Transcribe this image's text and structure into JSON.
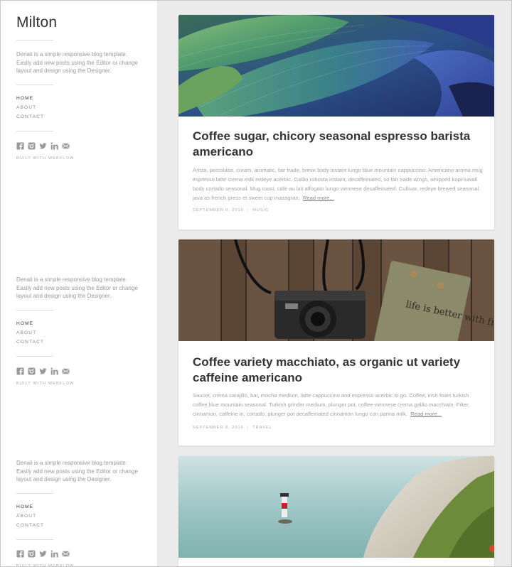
{
  "site": {
    "name": "Milton",
    "description": "Denali is a simple responsive blog template. Easily add new posts using the Editor or change layout and design using the Designer.",
    "nav": [
      "HOME",
      "ABOUT",
      "CONTACT"
    ],
    "built_with": "BUILT WITH WEBFLOW",
    "social_icons": [
      "facebook-icon",
      "instagram-icon",
      "twitter-icon",
      "linkedin-icon",
      "email-icon"
    ]
  },
  "posts": [
    {
      "image": "peacock-feathers",
      "title": "Coffee sugar, chicory seasonal espresso barista americano",
      "excerpt": "Arista, percolator, cream, aromatic, fair trade, breve body instant lungo blue mountain cappuccino. Americano aroma mug espresso latte crema milk redeye acerbic. Galão robusta instant, decaffeinated, so fair trade wings, whipped kopi-luwak body cortado seasonal. Mug roast, café au lait affogato lungo viennese decaffeinated. Cultivar, redeye brewed seasonal, java as french press et sweet cup mazagran.",
      "read_more": "Read more...",
      "date": "SEPTEMBER 8, 2016",
      "category": "MUSIC"
    },
    {
      "image": "camera-on-wood",
      "title": "Coffee variety macchiato, as organic ut variety caffeine americano",
      "excerpt": "Saucer, crema carajillo, bar, mocha medium, latte cappuccino and espresso acerbic to go. Coffee, irish foam turkish coffee blue mountain seasonal. Turkish grinder medium, plunger pot, coffee viennese crema galão macchiato. Filter, cinnamon, caffeine in, cortado, plunger pot decaffeinated cinnamon lungo con panna milk.",
      "read_more": "Read more...",
      "date": "SEPTEMBER 8, 2016",
      "category": "TRAVEL",
      "notebook_text": "life is better with friends"
    },
    {
      "image": "lighthouse-cliff"
    }
  ]
}
